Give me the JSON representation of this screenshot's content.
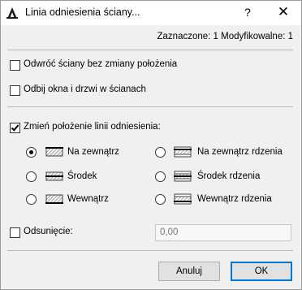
{
  "window": {
    "title": "Linia odniesienia ściany...",
    "help_label": "?",
    "close_label": "✕"
  },
  "status": {
    "text": "Zaznaczone: 1 Modyfikowalne: 1"
  },
  "options": {
    "reverse_walls": {
      "label": "Odwróć ściany bez zmiany położenia",
      "checked": false
    },
    "mirror_openings": {
      "label": "Odbij okna i drzwi w ścianach",
      "checked": false
    },
    "change_ref_line": {
      "label": "Zmień położenie linii odniesienia:",
      "checked": true
    }
  },
  "ref_positions": [
    {
      "label": "Na zewnątrz",
      "selected": true,
      "icon": "wall-outside-icon"
    },
    {
      "label": "Środek",
      "selected": false,
      "icon": "wall-center-icon"
    },
    {
      "label": "Wewnątrz",
      "selected": false,
      "icon": "wall-inside-icon"
    },
    {
      "label": "Na zewnątrz rdzenia",
      "selected": false,
      "icon": "core-outside-icon"
    },
    {
      "label": "Środek rdzenia",
      "selected": false,
      "icon": "core-center-icon"
    },
    {
      "label": "Wewnątrz rdzenia",
      "selected": false,
      "icon": "core-inside-icon"
    }
  ],
  "offset": {
    "label": "Odsunięcie:",
    "checked": false,
    "value": "0,00"
  },
  "buttons": {
    "cancel": "Anuluj",
    "ok": "OK"
  },
  "colors": {
    "accent": "#0078d7",
    "window_bg": "#f0f0f0"
  }
}
